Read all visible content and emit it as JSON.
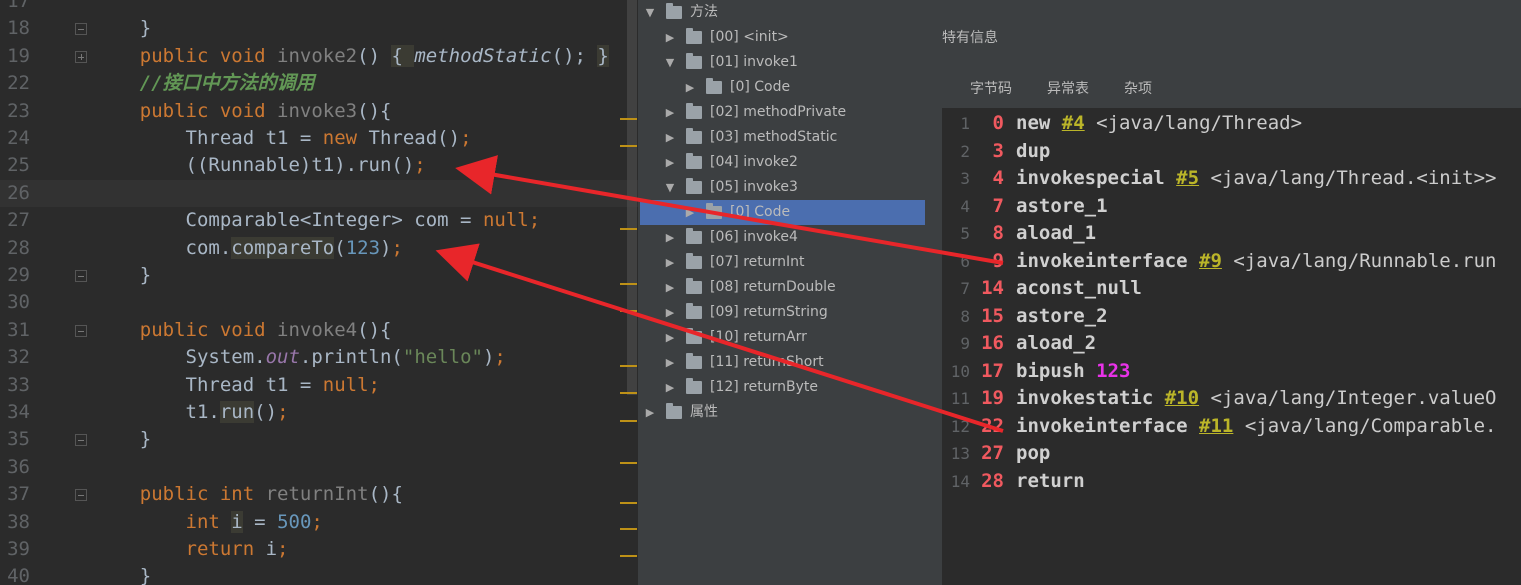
{
  "editor": {
    "lines": [
      {
        "num": "17",
        "tokens": []
      },
      {
        "num": "18",
        "tokens": [
          {
            "t": "    }",
            "c": ""
          }
        ]
      },
      {
        "num": "19",
        "tokens": [
          {
            "t": "    ",
            "c": ""
          },
          {
            "t": "public void ",
            "c": "kw"
          },
          {
            "t": "invoke2",
            "c": "unused"
          },
          {
            "t": "() ",
            "c": ""
          },
          {
            "t": "{ ",
            "c": "hl"
          },
          {
            "t": "methodStatic",
            "c": "ital"
          },
          {
            "t": "(); ",
            "c": ""
          },
          {
            "t": "}",
            "c": "hl"
          }
        ]
      },
      {
        "num": "22",
        "tokens": [
          {
            "t": "    //接口中方法的调用",
            "c": "cmt"
          }
        ]
      },
      {
        "num": "23",
        "tokens": [
          {
            "t": "    ",
            "c": ""
          },
          {
            "t": "public void ",
            "c": "kw"
          },
          {
            "t": "invoke3",
            "c": "unused"
          },
          {
            "t": "(){",
            "c": ""
          }
        ]
      },
      {
        "num": "24",
        "tokens": [
          {
            "t": "        Thread t1 = ",
            "c": ""
          },
          {
            "t": "new ",
            "c": "kw"
          },
          {
            "t": "Thread()",
            "c": ""
          },
          {
            "t": ";",
            "c": "kw"
          }
        ]
      },
      {
        "num": "25",
        "tokens": [
          {
            "t": "        ((Runnable)t1).run()",
            "c": ""
          },
          {
            "t": ";",
            "c": "kw"
          }
        ]
      },
      {
        "num": "26",
        "tokens": [],
        "current": true
      },
      {
        "num": "27",
        "tokens": [
          {
            "t": "        Comparable<Integer> com = ",
            "c": ""
          },
          {
            "t": "null",
            "c": "kw"
          },
          {
            "t": ";",
            "c": "kw"
          }
        ]
      },
      {
        "num": "28",
        "tokens": [
          {
            "t": "        com.",
            "c": ""
          },
          {
            "t": "compareTo",
            "c": "hl"
          },
          {
            "t": "(",
            "c": ""
          },
          {
            "t": "123",
            "c": "num"
          },
          {
            "t": ")",
            "c": ""
          },
          {
            "t": ";",
            "c": "kw"
          }
        ]
      },
      {
        "num": "29",
        "tokens": [
          {
            "t": "    }",
            "c": ""
          }
        ]
      },
      {
        "num": "30",
        "tokens": []
      },
      {
        "num": "31",
        "tokens": [
          {
            "t": "    ",
            "c": ""
          },
          {
            "t": "public void ",
            "c": "kw"
          },
          {
            "t": "invoke4",
            "c": "unused"
          },
          {
            "t": "(){",
            "c": ""
          }
        ]
      },
      {
        "num": "32",
        "tokens": [
          {
            "t": "        System.",
            "c": ""
          },
          {
            "t": "out",
            "c": "field"
          },
          {
            "t": ".println(",
            "c": ""
          },
          {
            "t": "\"hello\"",
            "c": "str"
          },
          {
            "t": ")",
            "c": ""
          },
          {
            "t": ";",
            "c": "kw"
          }
        ]
      },
      {
        "num": "33",
        "tokens": [
          {
            "t": "        Thread t1 = ",
            "c": ""
          },
          {
            "t": "null",
            "c": "kw"
          },
          {
            "t": ";",
            "c": "kw"
          }
        ]
      },
      {
        "num": "34",
        "tokens": [
          {
            "t": "        t1.",
            "c": ""
          },
          {
            "t": "run",
            "c": "hl"
          },
          {
            "t": "()",
            "c": ""
          },
          {
            "t": ";",
            "c": "kw"
          }
        ]
      },
      {
        "num": "35",
        "tokens": [
          {
            "t": "    }",
            "c": ""
          }
        ]
      },
      {
        "num": "36",
        "tokens": []
      },
      {
        "num": "37",
        "tokens": [
          {
            "t": "    ",
            "c": ""
          },
          {
            "t": "public int ",
            "c": "kw"
          },
          {
            "t": "returnInt",
            "c": "unused"
          },
          {
            "t": "(){",
            "c": ""
          }
        ]
      },
      {
        "num": "38",
        "tokens": [
          {
            "t": "        ",
            "c": ""
          },
          {
            "t": "int ",
            "c": "kw"
          },
          {
            "t": "i",
            "c": "hl"
          },
          {
            "t": " = ",
            "c": ""
          },
          {
            "t": "500",
            "c": "num"
          },
          {
            "t": ";",
            "c": "kw"
          }
        ]
      },
      {
        "num": "39",
        "tokens": [
          {
            "t": "        ",
            "c": ""
          },
          {
            "t": "return ",
            "c": "kw"
          },
          {
            "t": "i",
            "c": ""
          },
          {
            "t": ";",
            "c": "kw"
          }
        ]
      },
      {
        "num": "40",
        "tokens": [
          {
            "t": "    }",
            "c": ""
          }
        ]
      }
    ]
  },
  "tree": {
    "nodes": [
      {
        "label": "方法",
        "level": 0,
        "expanded": true
      },
      {
        "label": "[00] <init>",
        "level": 1,
        "expanded": false
      },
      {
        "label": "[01] invoke1",
        "level": 1,
        "expanded": true
      },
      {
        "label": "[0] Code",
        "level": 2,
        "expanded": false
      },
      {
        "label": "[02] methodPrivate",
        "level": 1,
        "expanded": false
      },
      {
        "label": "[03] methodStatic",
        "level": 1,
        "expanded": false
      },
      {
        "label": "[04] invoke2",
        "level": 1,
        "expanded": false
      },
      {
        "label": "[05] invoke3",
        "level": 1,
        "expanded": true
      },
      {
        "label": "[0] Code",
        "level": 2,
        "expanded": false,
        "selected": true
      },
      {
        "label": "[06] invoke4",
        "level": 1,
        "expanded": false
      },
      {
        "label": "[07] returnInt",
        "level": 1,
        "expanded": false
      },
      {
        "label": "[08] returnDouble",
        "level": 1,
        "expanded": false
      },
      {
        "label": "[09] returnString",
        "level": 1,
        "expanded": false
      },
      {
        "label": "[10] returnArr",
        "level": 1,
        "expanded": false
      },
      {
        "label": "[11] returnShort",
        "level": 1,
        "expanded": false
      },
      {
        "label": "[12] returnByte",
        "level": 1,
        "expanded": false
      },
      {
        "label": "属性",
        "level": 0,
        "expanded": false
      }
    ]
  },
  "panel": {
    "title": "特有信息",
    "tabs": [
      "字节码",
      "异常表",
      "杂项"
    ],
    "active_tab": 0
  },
  "bytecode": [
    {
      "n": "1",
      "off": "0",
      "op": "new",
      "ref": "#4",
      "cmt": "<java/lang/Thread>"
    },
    {
      "n": "2",
      "off": "3",
      "op": "dup"
    },
    {
      "n": "3",
      "off": "4",
      "op": "invokespecial",
      "ref": "#5",
      "cmt": "<java/lang/Thread.<init>>"
    },
    {
      "n": "4",
      "off": "7",
      "op": "astore_1"
    },
    {
      "n": "5",
      "off": "8",
      "op": "aload_1"
    },
    {
      "n": "6",
      "off": "9",
      "op": "invokeinterface",
      "ref": "#9",
      "cmt": "<java/lang/Runnable.run"
    },
    {
      "n": "7",
      "off": "14",
      "op": "aconst_null"
    },
    {
      "n": "8",
      "off": "15",
      "op": "astore_2"
    },
    {
      "n": "9",
      "off": "16",
      "op": "aload_2"
    },
    {
      "n": "10",
      "off": "17",
      "op": "bipush",
      "lit": "123"
    },
    {
      "n": "11",
      "off": "19",
      "op": "invokestatic",
      "ref": "#10",
      "cmt": "<java/lang/Integer.valueO"
    },
    {
      "n": "12",
      "off": "22",
      "op": "invokeinterface",
      "ref": "#11",
      "cmt": "<java/lang/Comparable."
    },
    {
      "n": "13",
      "off": "27",
      "op": "pop"
    },
    {
      "n": "14",
      "off": "28",
      "op": "return"
    }
  ],
  "colors": {
    "editor_bg": "#2b2b2b",
    "keyword": "#cc7832",
    "panel_bg": "#3c3f41",
    "selection": "#4b6eaf",
    "offset": "#f0595f",
    "annotation_arrow": "#e8262a"
  }
}
